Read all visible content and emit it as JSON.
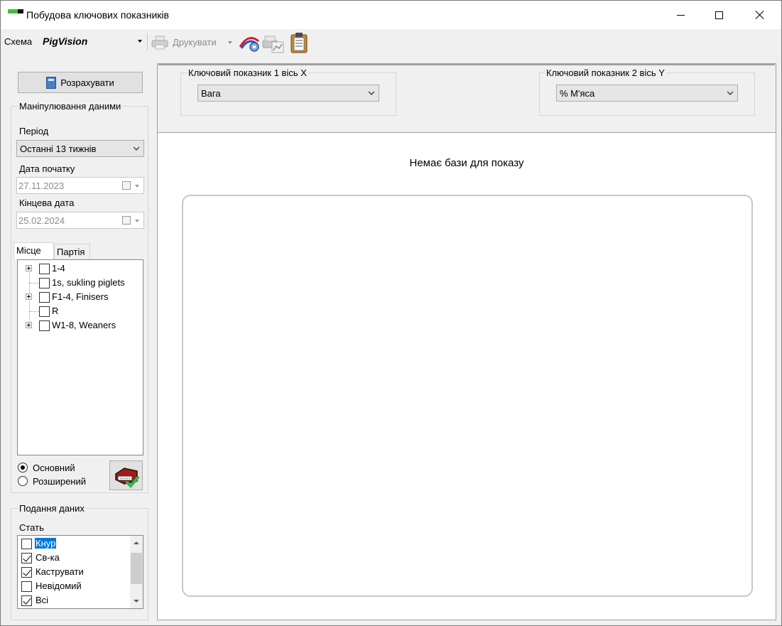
{
  "window": {
    "title": "Побудова ключових показників"
  },
  "toolbar": {
    "schema_label": "Схема",
    "schema_value": "PigVision",
    "print_label": "Друкувати"
  },
  "left": {
    "calc_button": "Розрахувати",
    "data_group_label": "Маніпулювання даними",
    "period_label": "Період",
    "period_value": "Останні 13 тижнів",
    "start_date_label": "Дата початку",
    "start_date_value": "27.11.2023",
    "end_date_label": "Кінцева дата",
    "end_date_value": "25.02.2024",
    "tabs": [
      {
        "label": "Місце",
        "active": true
      },
      {
        "label": "Партія",
        "active": false
      }
    ],
    "tree": [
      {
        "label": "1-4",
        "expandable": true,
        "checked": false
      },
      {
        "label": "1s, sukling piglets",
        "expandable": false,
        "checked": false
      },
      {
        "label": "F1-4, Finisers",
        "expandable": true,
        "checked": false
      },
      {
        "label": "R",
        "expandable": false,
        "checked": false
      },
      {
        "label": "W1-8, Weaners",
        "expandable": true,
        "checked": false
      }
    ],
    "mode": [
      {
        "label": "Основний",
        "selected": true
      },
      {
        "label": "Розширений",
        "selected": false
      }
    ],
    "presentation_group_label": "Подання даних",
    "sex_label": "Стать",
    "sex_list": [
      {
        "label": "Кнур",
        "checked": false,
        "selected": true
      },
      {
        "label": "Св-ка",
        "checked": true,
        "selected": false
      },
      {
        "label": "Каструвати",
        "checked": true,
        "selected": false
      },
      {
        "label": "Невідомий",
        "checked": false,
        "selected": false
      },
      {
        "label": "Всі",
        "checked": true,
        "selected": false
      }
    ]
  },
  "main": {
    "kpi_x_label": "Ключовий показник 1 вісь  X",
    "kpi_x_value": "Вага",
    "kpi_y_label": "Ключовий показник 2 вісь  Y",
    "kpi_y_value": "% М'яса",
    "chart_message": "Немає бази для показу"
  },
  "colors": {
    "selection": "#0078d7",
    "window_bg": "#f0f0f0"
  }
}
